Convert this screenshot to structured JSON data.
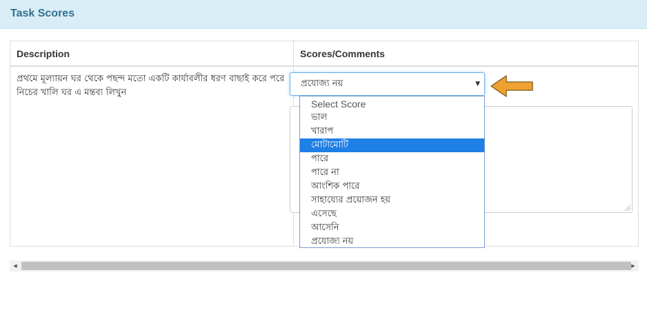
{
  "panel": {
    "title": "Task Scores"
  },
  "table": {
    "headers": {
      "description": "Description",
      "scores": "Scores/Comments"
    },
    "row": {
      "description": "প্রথমে মূল্যায়ন ঘর থেকে পছন্দ মতো একটি কার্যাবলীর ধরণ বাছাই করে পরে নিচের খালি ঘর এ মন্তব্য লিখুন"
    }
  },
  "score_select": {
    "value": "প্রযোজ্য নয়",
    "arrow": "▼",
    "options": [
      "Select Score",
      "ভাল",
      "খারাপ",
      "মোটামোটি",
      "পারে",
      "পারে না",
      "আংশিক পারে",
      "সাহায্যের প্রয়োজন হয়",
      "এসেছে",
      "আসেনি",
      "প্রযোজ্য নয়"
    ],
    "highlighted_option": "মোটামোটি"
  },
  "annotation": {
    "arrow_color": "#f0a030",
    "arrow_outline": "#8a6a2a"
  },
  "scrollbar": {
    "left_arrow": "◀",
    "right_arrow": "▶"
  },
  "colors": {
    "panel_heading_bg": "#d9edf7",
    "panel_title": "#31708f",
    "highlight": "#1e7fe6"
  }
}
